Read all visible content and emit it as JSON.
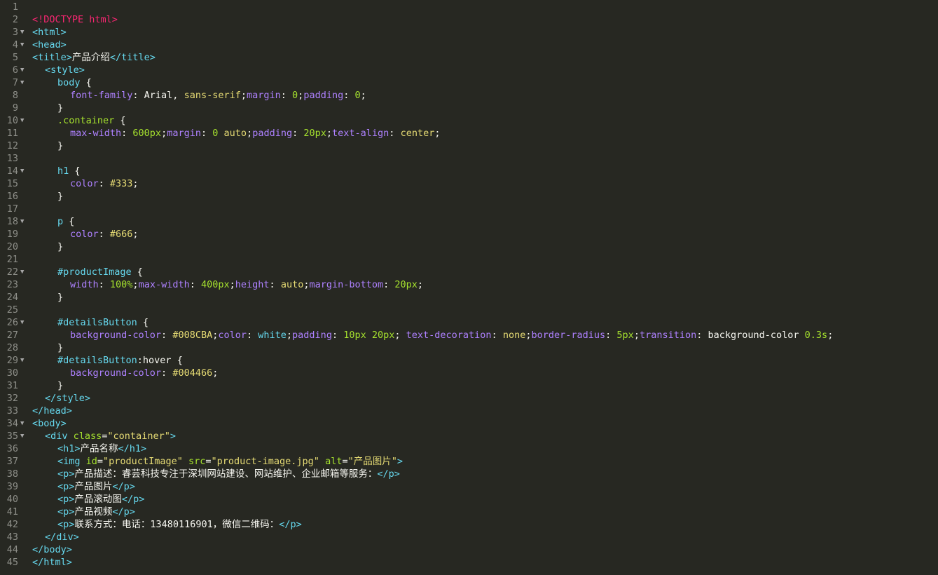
{
  "colors": {
    "background": "#272822",
    "gutter_text": "#8f908a",
    "tag": "#66d9ef",
    "doctype": "#f92672",
    "attribute": "#a6e22e",
    "string": "#e6db74",
    "property": "#ae81ff",
    "number": "#a6e22e",
    "text": "#f8f8f2"
  },
  "lines": [
    {
      "n": "1",
      "fold": false,
      "indent": 0,
      "tokens": []
    },
    {
      "n": "2",
      "fold": false,
      "indent": 0,
      "tokens": [
        {
          "t": "<!DOCTYPE html>",
          "c": "doctype"
        }
      ]
    },
    {
      "n": "3",
      "fold": true,
      "indent": 0,
      "tokens": [
        {
          "t": "<html>",
          "c": "tag"
        }
      ]
    },
    {
      "n": "4",
      "fold": true,
      "indent": 0,
      "tokens": [
        {
          "t": "<head>",
          "c": "tag"
        }
      ]
    },
    {
      "n": "5",
      "fold": false,
      "indent": 0,
      "tokens": [
        {
          "t": "<title>",
          "c": "tag"
        },
        {
          "t": "产品介绍",
          "c": "text"
        },
        {
          "t": "</title>",
          "c": "tag"
        }
      ]
    },
    {
      "n": "6",
      "fold": true,
      "indent": 1,
      "tokens": [
        {
          "t": "<style>",
          "c": "tag"
        }
      ]
    },
    {
      "n": "7",
      "fold": true,
      "indent": 2,
      "tokens": [
        {
          "t": "body",
          "c": "sel"
        },
        {
          "t": " {",
          "c": "punc"
        }
      ]
    },
    {
      "n": "8",
      "fold": false,
      "indent": 3,
      "tokens": [
        {
          "t": "font-family",
          "c": "prop"
        },
        {
          "t": ": Arial, ",
          "c": "punc"
        },
        {
          "t": "sans-serif",
          "c": "val"
        },
        {
          "t": ";",
          "c": "punc"
        },
        {
          "t": "margin",
          "c": "prop"
        },
        {
          "t": ": ",
          "c": "punc"
        },
        {
          "t": "0",
          "c": "num"
        },
        {
          "t": ";",
          "c": "punc"
        },
        {
          "t": "padding",
          "c": "prop"
        },
        {
          "t": ": ",
          "c": "punc"
        },
        {
          "t": "0",
          "c": "num"
        },
        {
          "t": ";",
          "c": "punc"
        }
      ]
    },
    {
      "n": "9",
      "fold": false,
      "indent": 2,
      "tokens": [
        {
          "t": "}",
          "c": "punc"
        }
      ]
    },
    {
      "n": "10",
      "fold": true,
      "indent": 2,
      "tokens": [
        {
          "t": ".container",
          "c": "attr"
        },
        {
          "t": " {",
          "c": "punc"
        }
      ]
    },
    {
      "n": "11",
      "fold": false,
      "indent": 3,
      "tokens": [
        {
          "t": "max-width",
          "c": "prop"
        },
        {
          "t": ": ",
          "c": "punc"
        },
        {
          "t": "600px",
          "c": "num"
        },
        {
          "t": ";",
          "c": "punc"
        },
        {
          "t": "margin",
          "c": "prop"
        },
        {
          "t": ": ",
          "c": "punc"
        },
        {
          "t": "0",
          "c": "num"
        },
        {
          "t": " ",
          "c": "punc"
        },
        {
          "t": "auto",
          "c": "val"
        },
        {
          "t": ";",
          "c": "punc"
        },
        {
          "t": "padding",
          "c": "prop"
        },
        {
          "t": ": ",
          "c": "punc"
        },
        {
          "t": "20px",
          "c": "num"
        },
        {
          "t": ";",
          "c": "punc"
        },
        {
          "t": "text-align",
          "c": "prop"
        },
        {
          "t": ": ",
          "c": "punc"
        },
        {
          "t": "center",
          "c": "val"
        },
        {
          "t": ";",
          "c": "punc"
        }
      ]
    },
    {
      "n": "12",
      "fold": false,
      "indent": 2,
      "tokens": [
        {
          "t": "}",
          "c": "punc"
        }
      ]
    },
    {
      "n": "13",
      "fold": false,
      "indent": 0,
      "tokens": []
    },
    {
      "n": "14",
      "fold": true,
      "indent": 2,
      "tokens": [
        {
          "t": "h1",
          "c": "sel"
        },
        {
          "t": " {",
          "c": "punc"
        }
      ]
    },
    {
      "n": "15",
      "fold": false,
      "indent": 3,
      "tokens": [
        {
          "t": "color",
          "c": "prop"
        },
        {
          "t": ": ",
          "c": "punc"
        },
        {
          "t": "#333",
          "c": "val"
        },
        {
          "t": ";",
          "c": "punc"
        }
      ]
    },
    {
      "n": "16",
      "fold": false,
      "indent": 2,
      "tokens": [
        {
          "t": "}",
          "c": "punc"
        }
      ]
    },
    {
      "n": "17",
      "fold": false,
      "indent": 0,
      "tokens": []
    },
    {
      "n": "18",
      "fold": true,
      "indent": 2,
      "tokens": [
        {
          "t": "p",
          "c": "sel"
        },
        {
          "t": " {",
          "c": "punc"
        }
      ]
    },
    {
      "n": "19",
      "fold": false,
      "indent": 3,
      "tokens": [
        {
          "t": "color",
          "c": "prop"
        },
        {
          "t": ": ",
          "c": "punc"
        },
        {
          "t": "#666",
          "c": "val"
        },
        {
          "t": ";",
          "c": "punc"
        }
      ]
    },
    {
      "n": "20",
      "fold": false,
      "indent": 2,
      "tokens": [
        {
          "t": "}",
          "c": "punc"
        }
      ]
    },
    {
      "n": "21",
      "fold": false,
      "indent": 0,
      "tokens": []
    },
    {
      "n": "22",
      "fold": true,
      "indent": 2,
      "tokens": [
        {
          "t": "#productImage",
          "c": "sel"
        },
        {
          "t": " {",
          "c": "punc"
        }
      ]
    },
    {
      "n": "23",
      "fold": false,
      "indent": 3,
      "tokens": [
        {
          "t": "width",
          "c": "prop"
        },
        {
          "t": ": ",
          "c": "punc"
        },
        {
          "t": "100%",
          "c": "num"
        },
        {
          "t": ";",
          "c": "punc"
        },
        {
          "t": "max-width",
          "c": "prop"
        },
        {
          "t": ": ",
          "c": "punc"
        },
        {
          "t": "400px",
          "c": "num"
        },
        {
          "t": ";",
          "c": "punc"
        },
        {
          "t": "height",
          "c": "prop"
        },
        {
          "t": ": ",
          "c": "punc"
        },
        {
          "t": "auto",
          "c": "val"
        },
        {
          "t": ";",
          "c": "punc"
        },
        {
          "t": "margin-bottom",
          "c": "prop"
        },
        {
          "t": ": ",
          "c": "punc"
        },
        {
          "t": "20px",
          "c": "num"
        },
        {
          "t": ";",
          "c": "punc"
        }
      ]
    },
    {
      "n": "24",
      "fold": false,
      "indent": 2,
      "tokens": [
        {
          "t": "}",
          "c": "punc"
        }
      ]
    },
    {
      "n": "25",
      "fold": false,
      "indent": 0,
      "tokens": []
    },
    {
      "n": "26",
      "fold": true,
      "indent": 2,
      "tokens": [
        {
          "t": "#detailsButton",
          "c": "sel"
        },
        {
          "t": " {",
          "c": "punc"
        }
      ]
    },
    {
      "n": "27",
      "fold": false,
      "indent": 3,
      "tokens": [
        {
          "t": "background-color",
          "c": "prop"
        },
        {
          "t": ": ",
          "c": "punc"
        },
        {
          "t": "#008CBA",
          "c": "val"
        },
        {
          "t": ";",
          "c": "punc"
        },
        {
          "t": "color",
          "c": "prop"
        },
        {
          "t": ": ",
          "c": "punc"
        },
        {
          "t": "white",
          "c": "sel"
        },
        {
          "t": ";",
          "c": "punc"
        },
        {
          "t": "padding",
          "c": "prop"
        },
        {
          "t": ": ",
          "c": "punc"
        },
        {
          "t": "10px 20px",
          "c": "num"
        },
        {
          "t": "; ",
          "c": "punc"
        },
        {
          "t": "text-decoration",
          "c": "prop"
        },
        {
          "t": ": ",
          "c": "punc"
        },
        {
          "t": "none",
          "c": "val"
        },
        {
          "t": ";",
          "c": "punc"
        },
        {
          "t": "border-radius",
          "c": "prop"
        },
        {
          "t": ": ",
          "c": "punc"
        },
        {
          "t": "5px",
          "c": "num"
        },
        {
          "t": ";",
          "c": "punc"
        },
        {
          "t": "transition",
          "c": "prop"
        },
        {
          "t": ": background-color ",
          "c": "punc"
        },
        {
          "t": "0.3s",
          "c": "num"
        },
        {
          "t": ";",
          "c": "punc"
        }
      ]
    },
    {
      "n": "28",
      "fold": false,
      "indent": 2,
      "tokens": [
        {
          "t": "}",
          "c": "punc"
        }
      ]
    },
    {
      "n": "29",
      "fold": true,
      "indent": 2,
      "tokens": [
        {
          "t": "#detailsButton",
          "c": "sel"
        },
        {
          "t": ":hover {",
          "c": "punc"
        }
      ]
    },
    {
      "n": "30",
      "fold": false,
      "indent": 3,
      "tokens": [
        {
          "t": "background-color",
          "c": "prop"
        },
        {
          "t": ": ",
          "c": "punc"
        },
        {
          "t": "#004466",
          "c": "val"
        },
        {
          "t": ";",
          "c": "punc"
        }
      ]
    },
    {
      "n": "31",
      "fold": false,
      "indent": 2,
      "tokens": [
        {
          "t": "}",
          "c": "punc"
        }
      ]
    },
    {
      "n": "32",
      "fold": false,
      "indent": 1,
      "tokens": [
        {
          "t": "</style>",
          "c": "tag"
        }
      ]
    },
    {
      "n": "33",
      "fold": false,
      "indent": 0,
      "tokens": [
        {
          "t": "</head>",
          "c": "tag"
        }
      ]
    },
    {
      "n": "34",
      "fold": true,
      "indent": 0,
      "tokens": [
        {
          "t": "<body>",
          "c": "tag"
        }
      ]
    },
    {
      "n": "35",
      "fold": true,
      "indent": 1,
      "tokens": [
        {
          "t": "<div ",
          "c": "tag"
        },
        {
          "t": "class",
          "c": "attr"
        },
        {
          "t": "=",
          "c": "punc"
        },
        {
          "t": "\"container\"",
          "c": "str"
        },
        {
          "t": ">",
          "c": "tag"
        }
      ]
    },
    {
      "n": "36",
      "fold": false,
      "indent": 2,
      "tokens": [
        {
          "t": "<h1>",
          "c": "tag"
        },
        {
          "t": "产品名称",
          "c": "text"
        },
        {
          "t": "</h1>",
          "c": "tag"
        }
      ]
    },
    {
      "n": "37",
      "fold": false,
      "indent": 2,
      "tokens": [
        {
          "t": "<img ",
          "c": "tag"
        },
        {
          "t": "id",
          "c": "attr"
        },
        {
          "t": "=",
          "c": "punc"
        },
        {
          "t": "\"productImage\"",
          "c": "str"
        },
        {
          "t": " ",
          "c": "punc"
        },
        {
          "t": "src",
          "c": "attr"
        },
        {
          "t": "=",
          "c": "punc"
        },
        {
          "t": "\"product-image.jpg\"",
          "c": "str"
        },
        {
          "t": " ",
          "c": "punc"
        },
        {
          "t": "alt",
          "c": "attr"
        },
        {
          "t": "=",
          "c": "punc"
        },
        {
          "t": "\"产品图片\"",
          "c": "str"
        },
        {
          "t": ">",
          "c": "tag"
        }
      ]
    },
    {
      "n": "38",
      "fold": false,
      "indent": 2,
      "tokens": [
        {
          "t": "<p>",
          "c": "tag"
        },
        {
          "t": "产品描述：睿芸科技专注于深圳网站建设、网站维护、企业邮箱等服务：",
          "c": "text"
        },
        {
          "t": "</p>",
          "c": "tag"
        }
      ]
    },
    {
      "n": "39",
      "fold": false,
      "indent": 2,
      "tokens": [
        {
          "t": "<p>",
          "c": "tag"
        },
        {
          "t": "产品图片",
          "c": "text"
        },
        {
          "t": "</p>",
          "c": "tag"
        }
      ]
    },
    {
      "n": "40",
      "fold": false,
      "indent": 2,
      "tokens": [
        {
          "t": "<p>",
          "c": "tag"
        },
        {
          "t": "产品滚动图",
          "c": "text"
        },
        {
          "t": "</p>",
          "c": "tag"
        }
      ]
    },
    {
      "n": "41",
      "fold": false,
      "indent": 2,
      "tokens": [
        {
          "t": "<p>",
          "c": "tag"
        },
        {
          "t": "产品视频",
          "c": "text"
        },
        {
          "t": "</p>",
          "c": "tag"
        }
      ]
    },
    {
      "n": "42",
      "fold": false,
      "indent": 2,
      "tokens": [
        {
          "t": "<p>",
          "c": "tag"
        },
        {
          "t": "联系方式：电话：13480116901，微信二维码：",
          "c": "text"
        },
        {
          "t": "</p>",
          "c": "tag"
        }
      ]
    },
    {
      "n": "43",
      "fold": false,
      "indent": 1,
      "tokens": [
        {
          "t": "</div>",
          "c": "tag"
        }
      ]
    },
    {
      "n": "44",
      "fold": false,
      "indent": 0,
      "tokens": [
        {
          "t": "</body>",
          "c": "tag"
        }
      ]
    },
    {
      "n": "45",
      "fold": false,
      "indent": 0,
      "tokens": [
        {
          "t": "</html>",
          "c": "tag"
        }
      ]
    }
  ]
}
